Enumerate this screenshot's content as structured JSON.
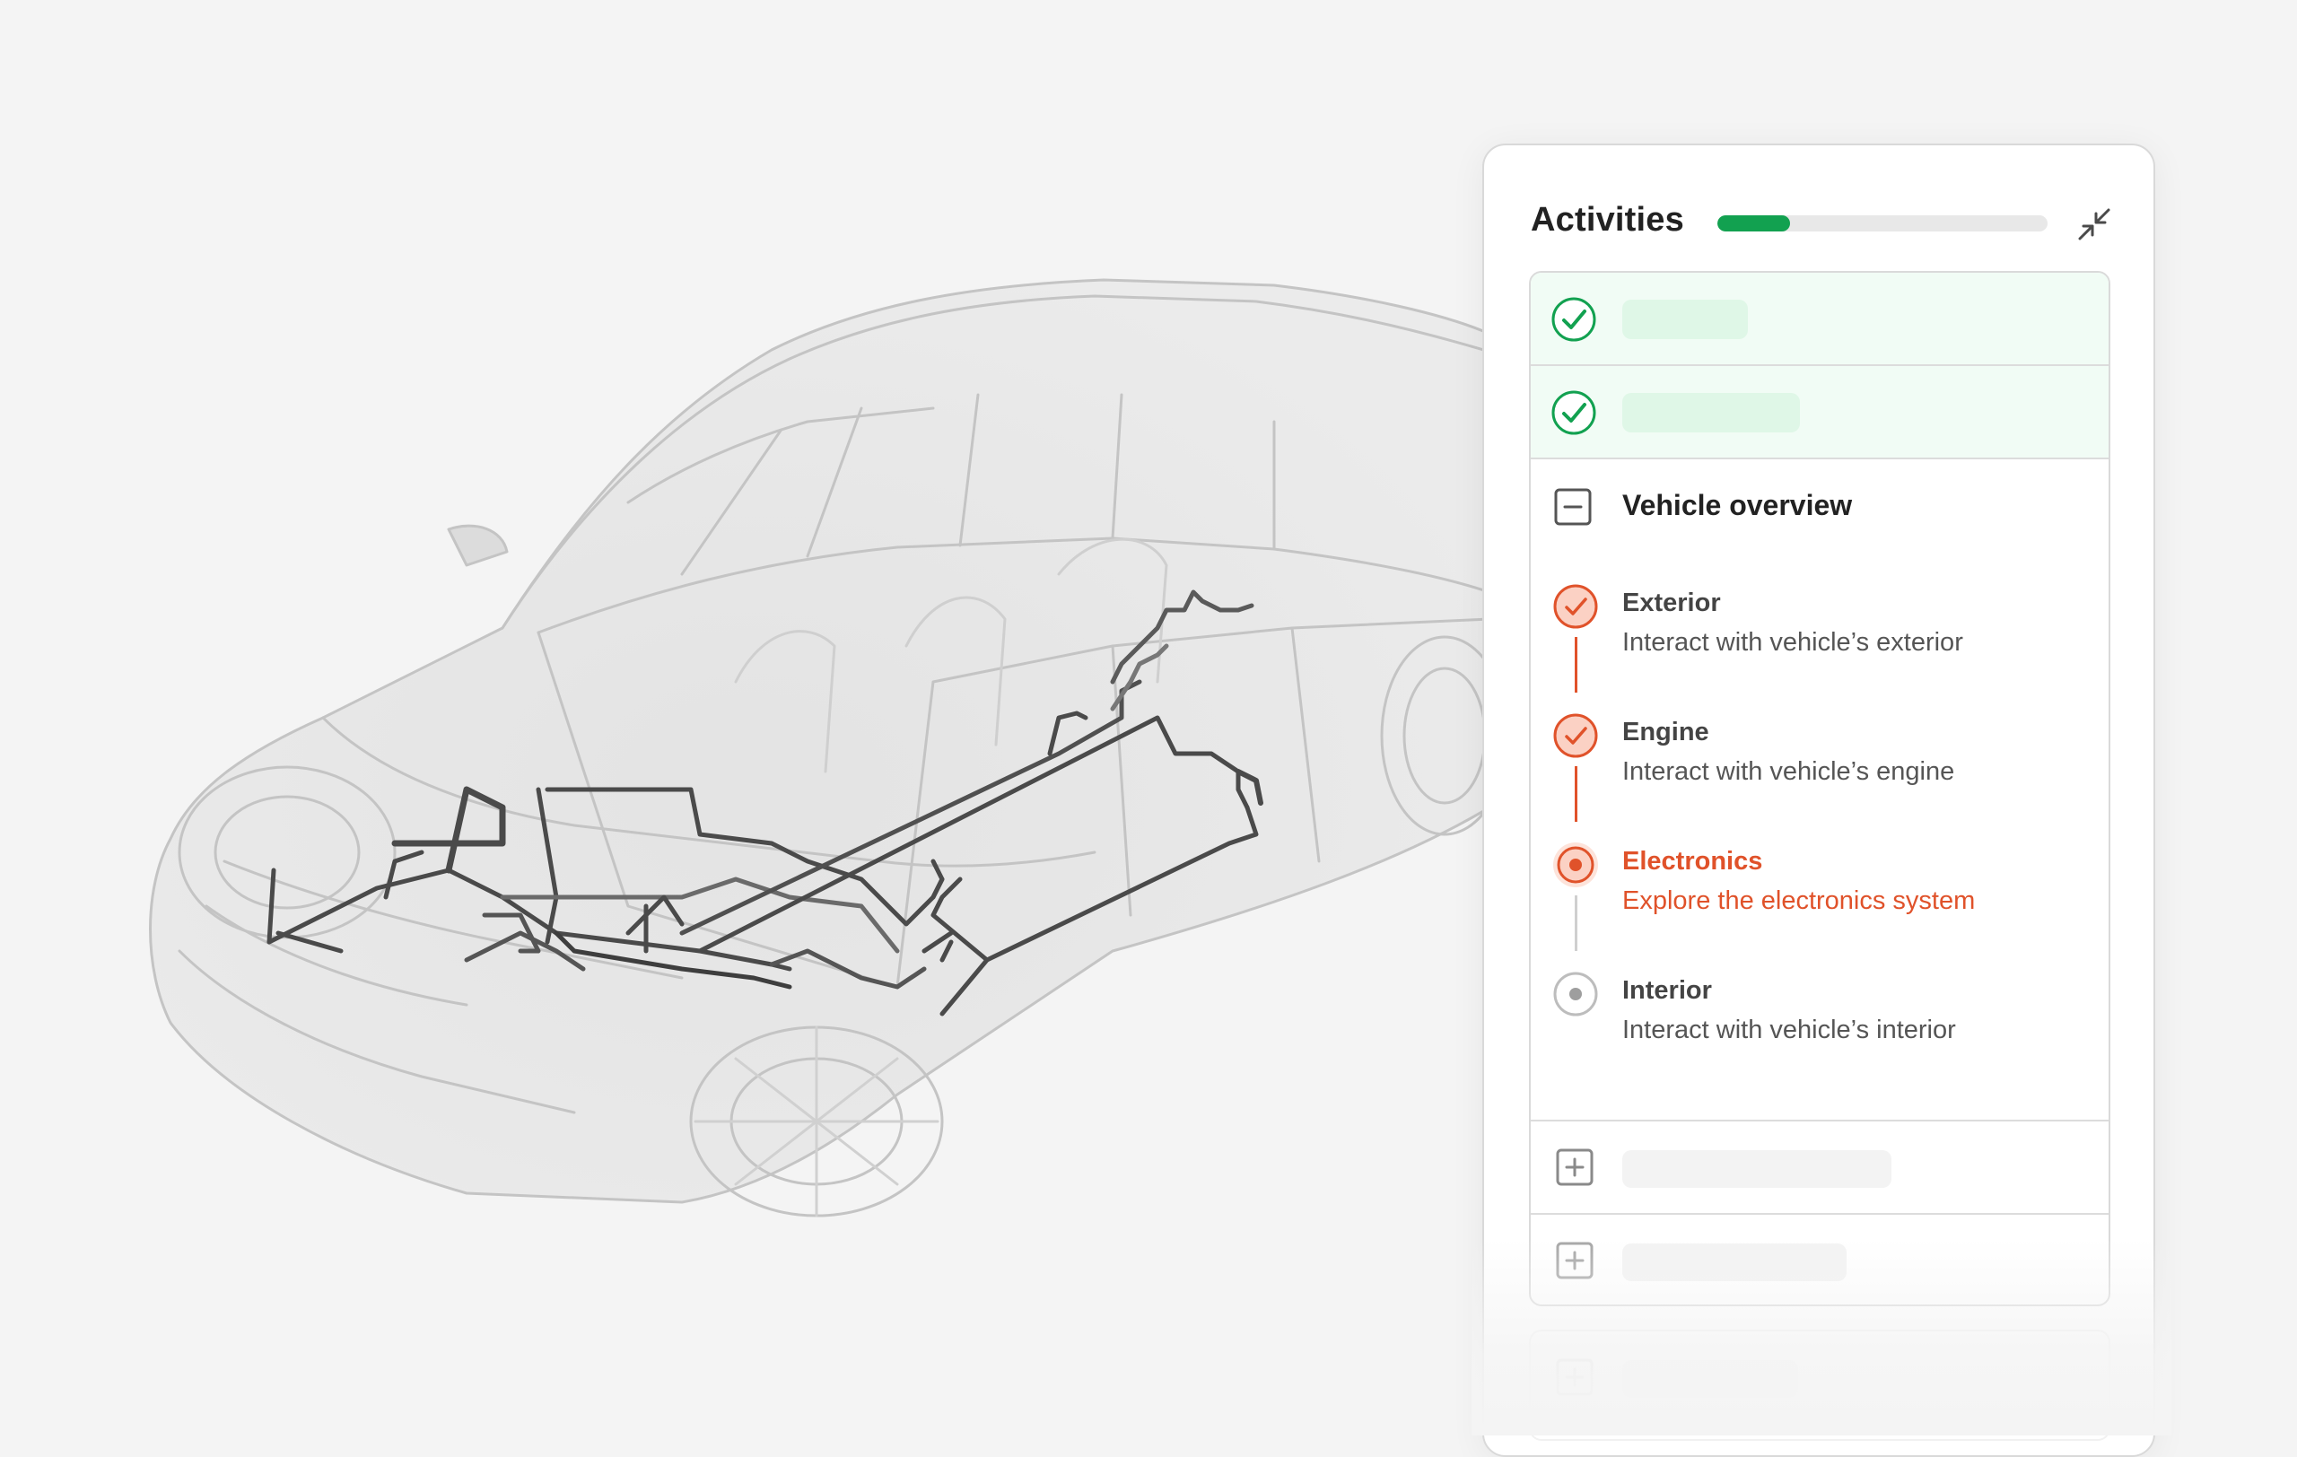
{
  "panel": {
    "title": "Activities",
    "progress_fraction": 0.22,
    "collapse_icon": "collapse-icon"
  },
  "colors": {
    "background": "#f4f4f4",
    "success": "#12a150",
    "success_bg": "#f1fcf5",
    "accent": "#e0522a",
    "accent_soft": "#fbd1c4",
    "neutral_icon": "#555555"
  },
  "completed_sections": [
    {
      "status": "complete",
      "icon": "check-circle-icon"
    },
    {
      "status": "complete",
      "icon": "check-circle-icon"
    }
  ],
  "section": {
    "title": "Vehicle overview",
    "icon": "minus-square-icon",
    "steps": [
      {
        "title": "Exterior",
        "description": "Interact with vehicle’s exterior",
        "status": "done"
      },
      {
        "title": "Engine",
        "description": "Interact with vehicle’s engine",
        "status": "done"
      },
      {
        "title": "Electronics",
        "description": "Explore the electronics system",
        "status": "active"
      },
      {
        "title": "Interior",
        "description": "Interact with vehicle’s interior",
        "status": "pending"
      }
    ]
  },
  "collapsed_sections": [
    {
      "icon": "plus-square-icon"
    },
    {
      "icon": "plus-square-icon"
    },
    {
      "icon": "plus-square-icon"
    }
  ],
  "scene": {
    "subject": "vehicle-3d-model"
  }
}
